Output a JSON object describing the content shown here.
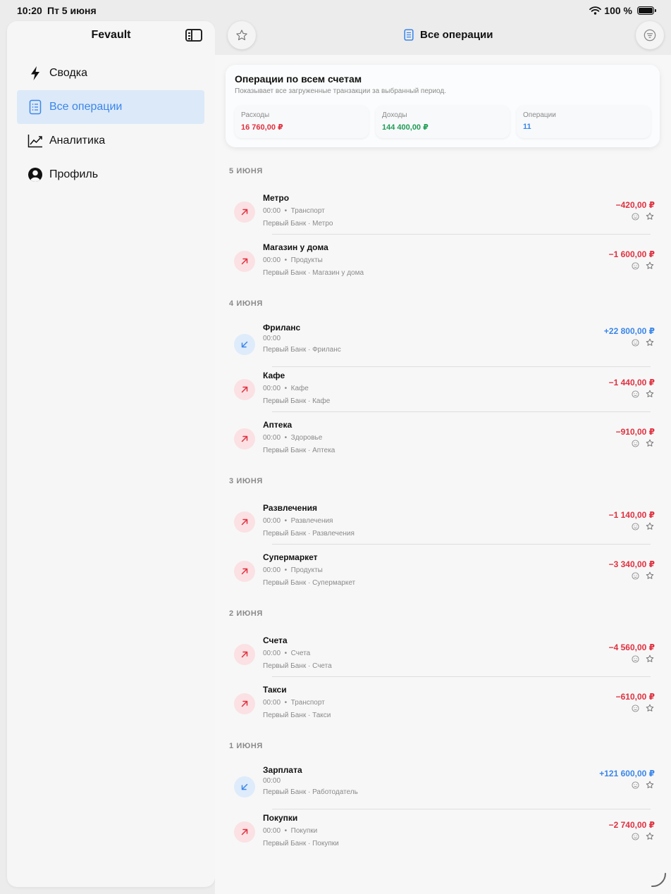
{
  "status": {
    "time": "10:20",
    "date": "Пт 5 июня",
    "battery": "100 %"
  },
  "sidebar": {
    "title": "Fevault",
    "items": [
      {
        "label": "Сводка",
        "icon": "bolt-icon"
      },
      {
        "label": "Все операции",
        "icon": "document-list-icon",
        "active": true
      },
      {
        "label": "Аналитика",
        "icon": "line-chart-icon"
      },
      {
        "label": "Профиль",
        "icon": "person-circle-icon"
      }
    ]
  },
  "toolbar": {
    "title": "Все операции"
  },
  "summary": {
    "title": "Операции по всем счетам",
    "subtitle": "Показывает все загруженные транзакции за выбранный период.",
    "expenses": {
      "label": "Расходы",
      "value": "16 760,00 ₽"
    },
    "income": {
      "label": "Доходы",
      "value": "144 400,00 ₽"
    },
    "count": {
      "label": "Операции",
      "value": "11"
    }
  },
  "colors": {
    "expense": "#e0303f",
    "income": "#3a86ea",
    "income_total": "#1f9d55",
    "accent": "#3a86ea"
  },
  "groups": [
    {
      "date": "5 ИЮНЯ",
      "items": [
        {
          "name": "Метро",
          "time": "00:00",
          "category": "Транспорт",
          "source": "Первый Банк · Метро",
          "amount": "−420,00 ₽",
          "type": "expense"
        },
        {
          "name": "Магазин у дома",
          "time": "00:00",
          "category": "Продукты",
          "source": "Первый Банк · Магазин у дома",
          "amount": "−1 600,00 ₽",
          "type": "expense"
        }
      ]
    },
    {
      "date": "4 ИЮНЯ",
      "items": [
        {
          "name": "Фриланс",
          "time": "00:00",
          "category": "",
          "source": "Первый Банк · Фриланс",
          "amount": "+22 800,00 ₽",
          "type": "income"
        },
        {
          "name": "Кафе",
          "time": "00:00",
          "category": "Кафе",
          "source": "Первый Банк · Кафе",
          "amount": "−1 440,00 ₽",
          "type": "expense"
        },
        {
          "name": "Аптека",
          "time": "00:00",
          "category": "Здоровье",
          "source": "Первый Банк · Аптека",
          "amount": "−910,00 ₽",
          "type": "expense"
        }
      ]
    },
    {
      "date": "3 ИЮНЯ",
      "items": [
        {
          "name": "Развлечения",
          "time": "00:00",
          "category": "Развлечения",
          "source": "Первый Банк · Развлечения",
          "amount": "−1 140,00 ₽",
          "type": "expense"
        },
        {
          "name": "Супермаркет",
          "time": "00:00",
          "category": "Продукты",
          "source": "Первый Банк · Супермаркет",
          "amount": "−3 340,00 ₽",
          "type": "expense"
        }
      ]
    },
    {
      "date": "2 ИЮНЯ",
      "items": [
        {
          "name": "Счета",
          "time": "00:00",
          "category": "Счета",
          "source": "Первый Банк · Счета",
          "amount": "−4 560,00 ₽",
          "type": "expense"
        },
        {
          "name": "Такси",
          "time": "00:00",
          "category": "Транспорт",
          "source": "Первый Банк · Такси",
          "amount": "−610,00 ₽",
          "type": "expense"
        }
      ]
    },
    {
      "date": "1 ИЮНЯ",
      "items": [
        {
          "name": "Зарплата",
          "time": "00:00",
          "category": "",
          "source": "Первый Банк · Работодатель",
          "amount": "+121 600,00 ₽",
          "type": "income"
        },
        {
          "name": "Покупки",
          "time": "00:00",
          "category": "Покупки",
          "source": "Первый Банк · Покупки",
          "amount": "−2 740,00 ₽",
          "type": "expense"
        }
      ]
    }
  ]
}
